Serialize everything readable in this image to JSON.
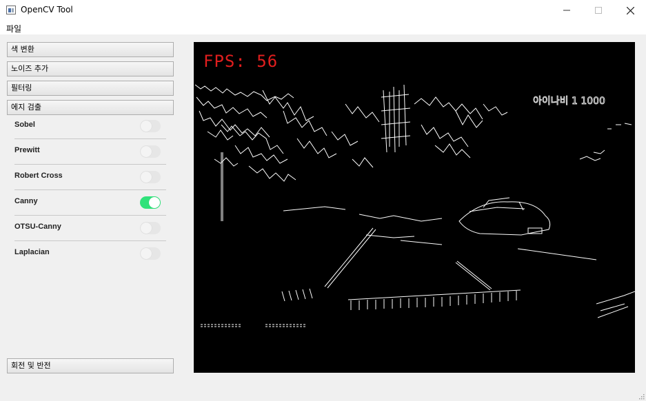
{
  "window": {
    "title": "OpenCV Tool",
    "minimize_icon": "minimize-icon",
    "maximize_icon": "maximize-icon",
    "close_icon": "close-icon"
  },
  "menu": {
    "file": "파일"
  },
  "sidebar": {
    "groups": [
      {
        "label": "색 변환"
      },
      {
        "label": "노이즈 추가"
      },
      {
        "label": "필터링"
      },
      {
        "label": "에지 검출"
      }
    ],
    "edge_options": [
      {
        "label": "Sobel",
        "on": false
      },
      {
        "label": "Prewitt",
        "on": false
      },
      {
        "label": "Robert Cross",
        "on": false
      },
      {
        "label": "Canny",
        "on": true
      },
      {
        "label": "OTSU-Canny",
        "on": false
      },
      {
        "label": "Laplacian",
        "on": false
      }
    ],
    "bottom_group": {
      "label": "회전 및 반전"
    }
  },
  "video": {
    "fps_text": "FPS: 56",
    "overlay_text": "아이나비 1 1000"
  },
  "colors": {
    "toggle_on": "#30e27a",
    "fps_text": "#e01e1e"
  }
}
